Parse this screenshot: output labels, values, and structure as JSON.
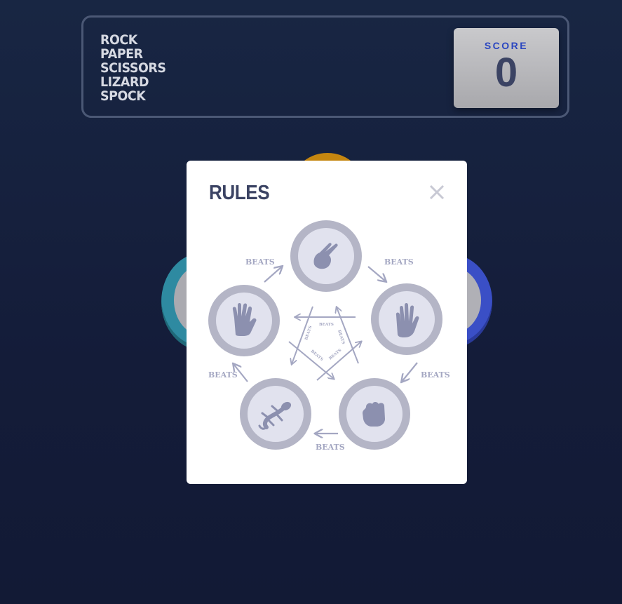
{
  "header": {
    "title_lines": [
      "Rock",
      "Paper",
      "Scissors",
      "Lizard",
      "Spock"
    ],
    "score_label": "SCORE",
    "score_value": "0"
  },
  "modal": {
    "title": "RULES",
    "close_icon": "close-icon",
    "beats_label": "BEATS",
    "inner_beats_label": "BEATS",
    "nodes": [
      {
        "name": "scissors",
        "icon": "scissors-hand-icon"
      },
      {
        "name": "paper",
        "icon": "paper-hand-icon"
      },
      {
        "name": "rock",
        "icon": "rock-fist-icon"
      },
      {
        "name": "lizard",
        "icon": "lizard-icon"
      },
      {
        "name": "spock",
        "icon": "spock-hand-icon"
      }
    ]
  },
  "colors": {
    "background": "#141c39",
    "score_label": "#2a46c0",
    "score_value": "#3b4363",
    "modal_title": "#3b4363",
    "diagram_ring": "#b4b5c6",
    "diagram_fill": "#e1e2ee",
    "diagram_icon": "#8c90af"
  }
}
